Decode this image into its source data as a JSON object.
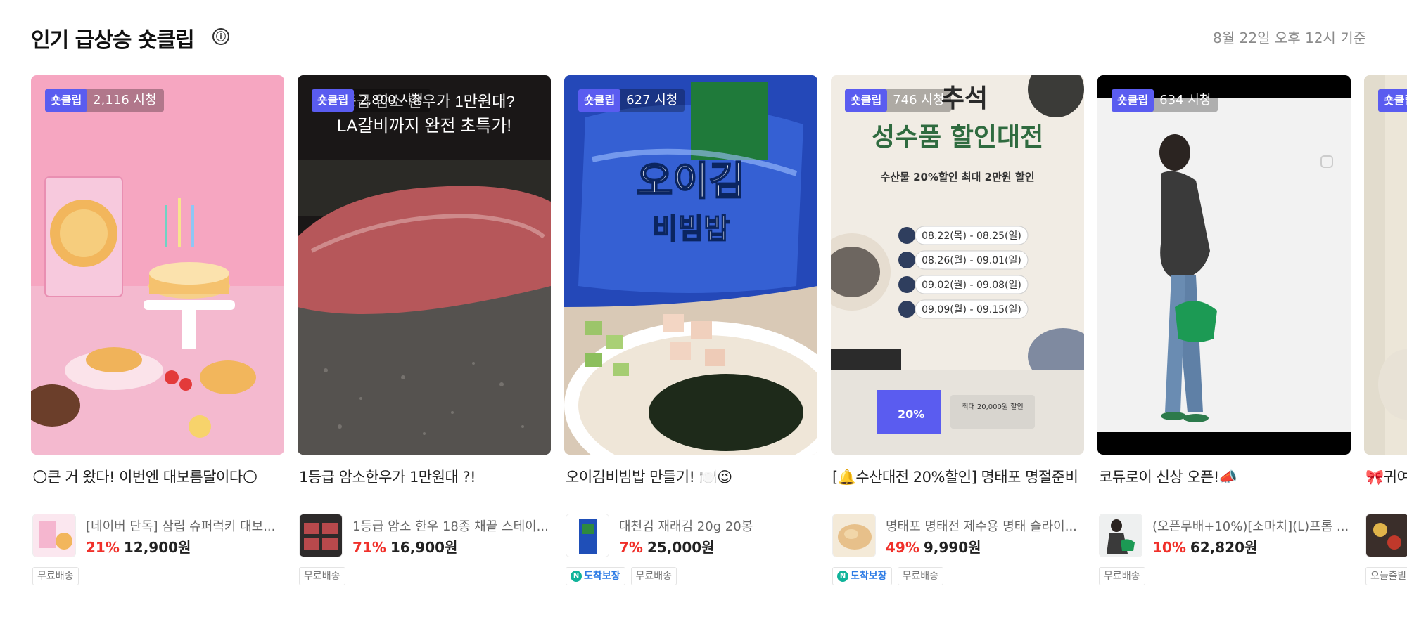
{
  "header": {
    "title": "인기 급상승 숏클립",
    "info_icon": "ⓘ",
    "timestamp": "8월 22일 오후 12시 기준"
  },
  "cards": [
    {
      "badge": "숏클립",
      "views": "2,116 시청",
      "overlay_lines": [],
      "title": "🌕큰 거 왔다! 이번엔 대보름달이다🌕",
      "product_name": "[네이버 단독] 삼립 슈퍼럭키 대보...",
      "discount": "21%",
      "price": "12,900원",
      "tags": [
        "무료배송"
      ]
    },
    {
      "badge": "숏클립",
      "views": "2,800 시청",
      "overlay_lines": [
        "1등급 암소 한우가 1만원대?",
        "LA갈비까지 완전 초특가!"
      ],
      "title": "1등급 암소한우가 1만원대 ?!",
      "product_name": "1등급 암소 한우 18종 채끝 스테이...",
      "discount": "71%",
      "price": "16,900원",
      "tags": [
        "무료배송"
      ]
    },
    {
      "badge": "숏클립",
      "views": "627 시청",
      "overlay_lines": [
        "오이김",
        "비빔밥"
      ],
      "title": "오이김비빔밥 만들기! 🍽️😉",
      "product_name": "대천김 재래김 20g 20봉",
      "discount": "7%",
      "price": "25,000원",
      "tags": [
        "도착보장",
        "무료배송"
      ]
    },
    {
      "badge": "숏클립",
      "views": "746 시청",
      "overlay_lines": [
        "추석",
        "성수품 할인대전",
        "수산물 20%할인  최대 2만원 할인",
        "08.22(목) - 08.25(일)",
        "08.26(월) - 09.01(일)",
        "09.02(월) - 09.08(일)",
        "09.09(월) - 09.15(일)",
        "20%",
        "최대 20,000원 할인"
      ],
      "title": "[🔔수산대전 20%할인] 명태포 명절준비",
      "product_name": "명태포 명태전 제수용 명태 슬라이...",
      "discount": "49%",
      "price": "9,990원",
      "tags": [
        "도착보장",
        "무료배송"
      ]
    },
    {
      "badge": "숏클립",
      "views": "634 시청",
      "overlay_lines": [],
      "title": "코듀로이 신상 오픈!📣",
      "product_name": "(오픈무배+10%)[소마치](L)프롬 ...",
      "discount": "10%",
      "price": "62,820원",
      "tags": [
        "무료배송"
      ]
    },
    {
      "badge": "숏클립",
      "views": "",
      "overlay_lines": [],
      "title": "🎀귀여",
      "product_name": "",
      "discount": "",
      "price": "",
      "tags": [
        "오늘출발"
      ]
    }
  ],
  "colors": {
    "badge": "#5a5cf0",
    "discount": "#f0302a",
    "arrival": "#10b39a"
  }
}
